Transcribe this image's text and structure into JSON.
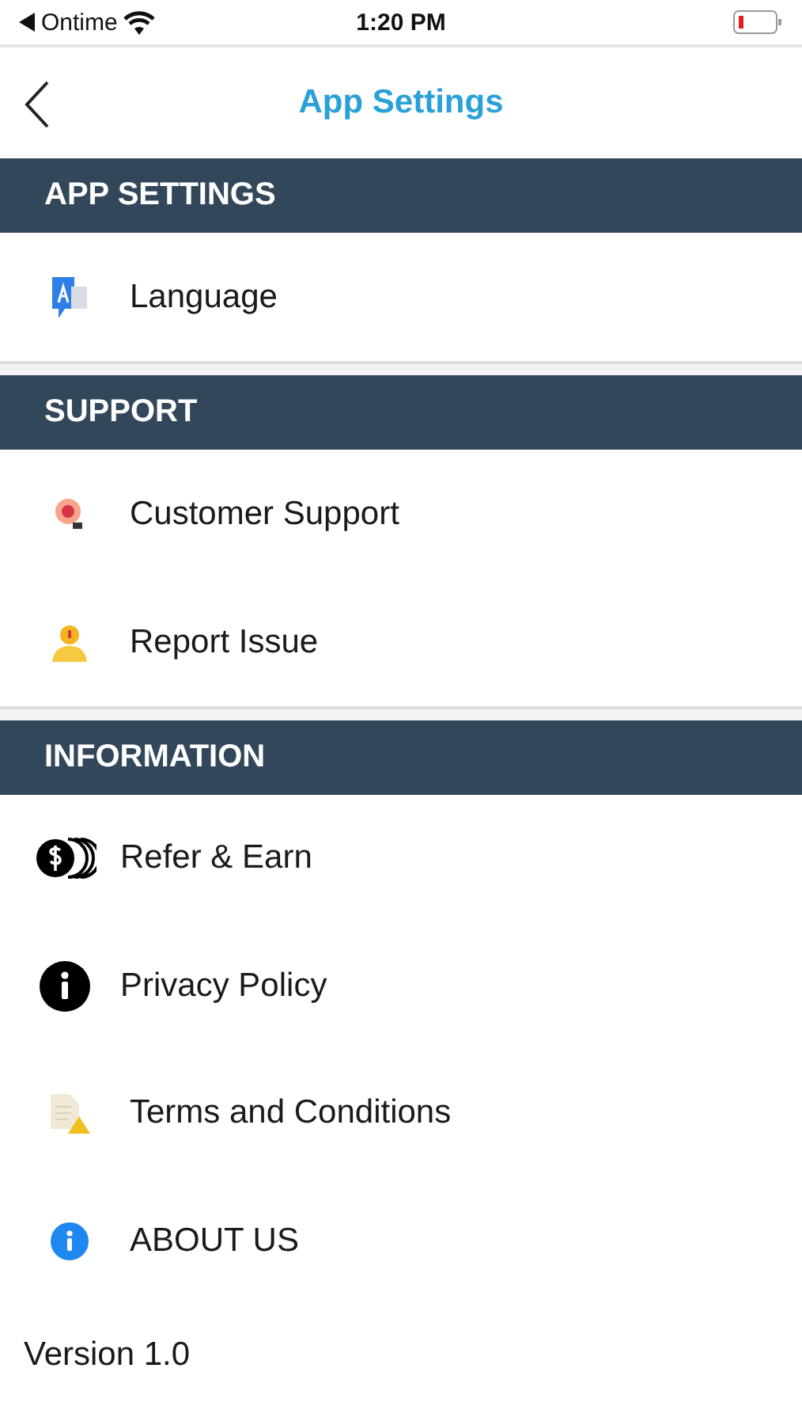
{
  "status_bar": {
    "back_app": "Ontime",
    "time": "1:20 PM"
  },
  "nav_bar": {
    "title": "App Settings"
  },
  "sections": [
    {
      "title": "APP SETTINGS",
      "items": [
        {
          "label": "Language",
          "kind": "language"
        }
      ]
    },
    {
      "title": "SUPPORT",
      "items": [
        {
          "label": "Customer Support",
          "kind": "support"
        },
        {
          "label": "Report Issue",
          "kind": "report"
        }
      ]
    },
    {
      "title": "INFORMATION",
      "items": [
        {
          "label": "Refer & Earn",
          "kind": "coins"
        },
        {
          "label": "Privacy Policy",
          "kind": "info-dark"
        },
        {
          "label": "Terms and Conditions",
          "kind": "document"
        },
        {
          "label": "ABOUT US",
          "kind": "info-blue"
        }
      ]
    }
  ],
  "version": "Version 1.0"
}
